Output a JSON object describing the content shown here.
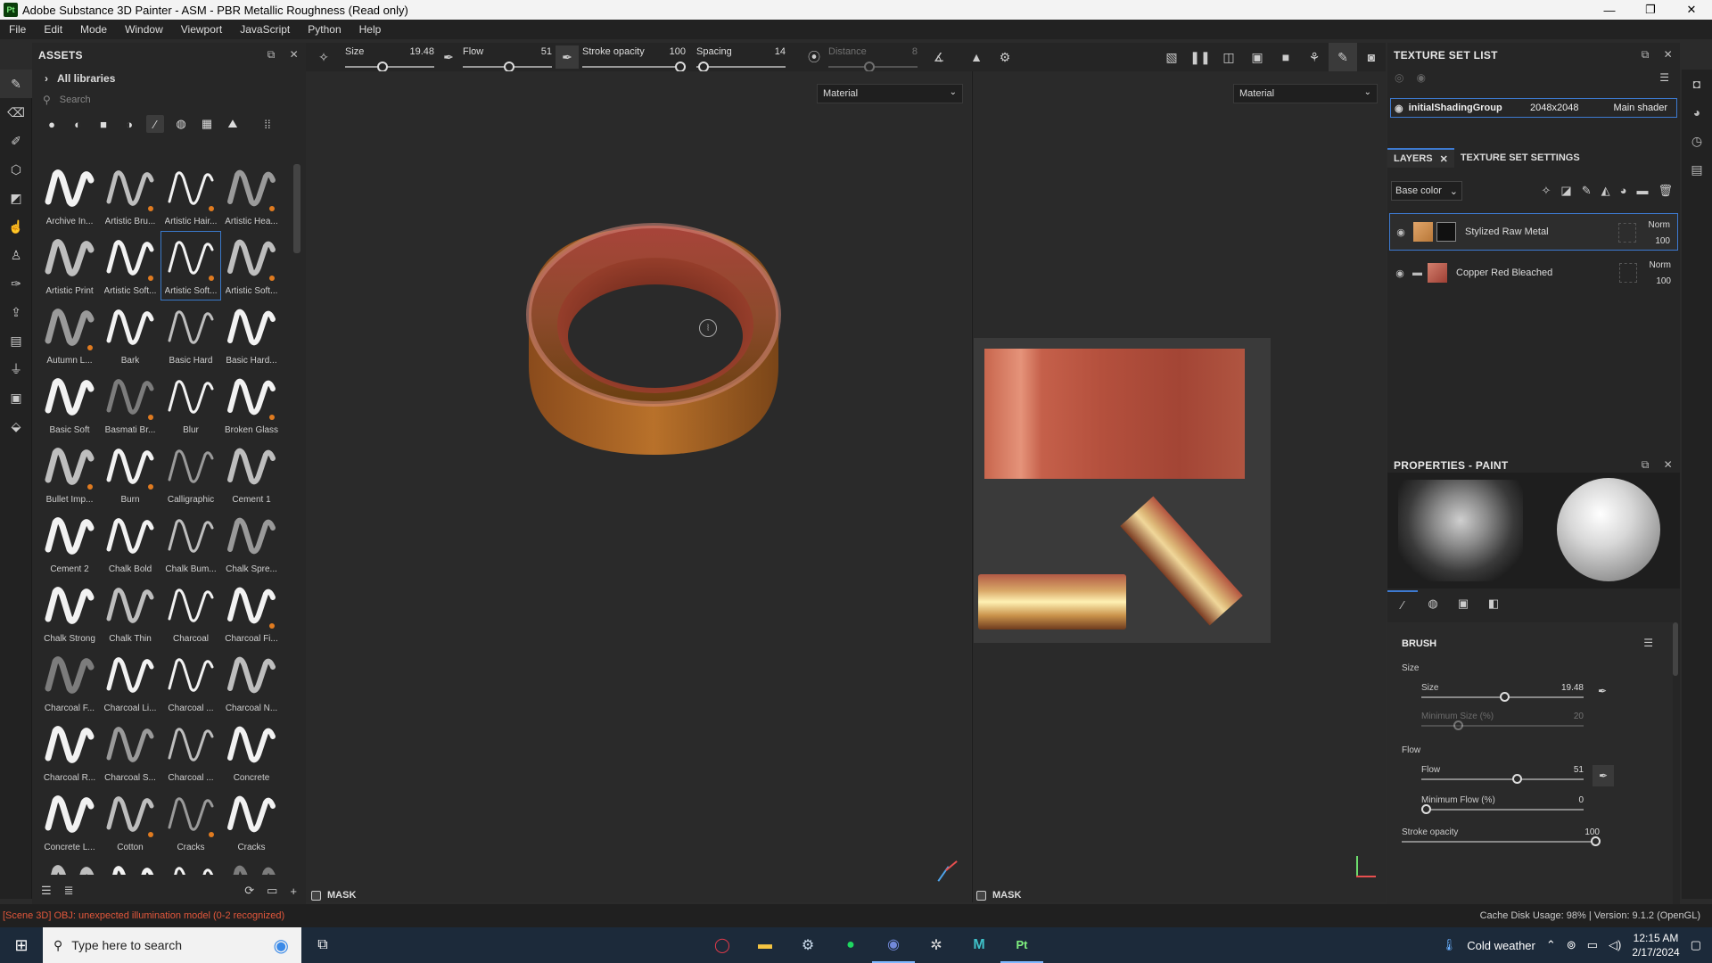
{
  "titlebar": {
    "title": "Adobe Substance 3D Painter - ASM - PBR Metallic Roughness (Read only)",
    "logo": "Pt"
  },
  "menu": [
    "File",
    "Edit",
    "Mode",
    "Window",
    "Viewport",
    "JavaScript",
    "Python",
    "Help"
  ],
  "assets": {
    "title": "ASSETS",
    "library": "All libraries",
    "search_placeholder": "Search",
    "items": [
      "Archive In...",
      "Artistic Bru...",
      "Artistic Hair...",
      "Artistic Hea...",
      "Artistic Print",
      "Artistic Soft...",
      "Artistic Soft...",
      "Artistic Soft...",
      "Autumn L...",
      "Bark",
      "Basic Hard",
      "Basic Hard...",
      "Basic Soft",
      "Basmati Br...",
      "Blur",
      "Broken Glass",
      "Bullet Imp...",
      "Burn",
      "Calligraphic",
      "Cement 1",
      "Cement 2",
      "Chalk Bold",
      "Chalk Bum...",
      "Chalk Spre...",
      "Chalk Strong",
      "Chalk Thin",
      "Charcoal",
      "Charcoal Fi...",
      "Charcoal F...",
      "Charcoal Li...",
      "Charcoal ...",
      "Charcoal N...",
      "Charcoal R...",
      "Charcoal S...",
      "Charcoal ...",
      "Concrete",
      "Concrete L...",
      "Cotton",
      "Cracks",
      "Cracks",
      "",
      "",
      "",
      ""
    ]
  },
  "toolbar": {
    "size_label": "Size",
    "size_value": "19.48",
    "flow_label": "Flow",
    "flow_value": "51",
    "stroke_label": "Stroke opacity",
    "stroke_value": "100",
    "spacing_label": "Spacing",
    "spacing_value": "14",
    "distance_label": "Distance",
    "distance_value": "8"
  },
  "viewport": {
    "material_3d": "Material",
    "material_2d": "Material",
    "mask_label_3d": "MASK",
    "mask_label_2d": "MASK"
  },
  "texture_set": {
    "title": "TEXTURE SET LIST",
    "name": "initialShadingGroup",
    "resolution": "2048x2048",
    "shader": "Main shader"
  },
  "layers": {
    "tab_layers": "LAYERS",
    "tab_tss": "TEXTURE SET SETTINGS",
    "channel": "Base color",
    "items": [
      {
        "name": "Stylized Raw Metal",
        "blend": "Norm",
        "opacity": "100"
      },
      {
        "name": "Copper Red Bleached",
        "blend": "Norm",
        "opacity": "100"
      }
    ]
  },
  "properties": {
    "title": "PROPERTIES - PAINT",
    "brush_title": "BRUSH",
    "size_section": "Size",
    "size_label": "Size",
    "size_value": "19.48",
    "minsize_label": "Minimum Size (%)",
    "minsize_value": "20",
    "flow_section": "Flow",
    "flow_label": "Flow",
    "flow_value": "51",
    "minflow_label": "Minimum Flow (%)",
    "minflow_value": "0",
    "stroke_label": "Stroke opacity",
    "stroke_value": "100"
  },
  "status": {
    "error": "[Scene 3D] OBJ: unexpected illumination model (0-2 recognized)",
    "info": "Cache Disk Usage:   98% | Version: 9.1.2 (OpenGL)"
  },
  "taskbar": {
    "search_placeholder": "Type here to search",
    "weather": "Cold weather",
    "time": "12:15 AM",
    "date": "2/17/2024"
  }
}
